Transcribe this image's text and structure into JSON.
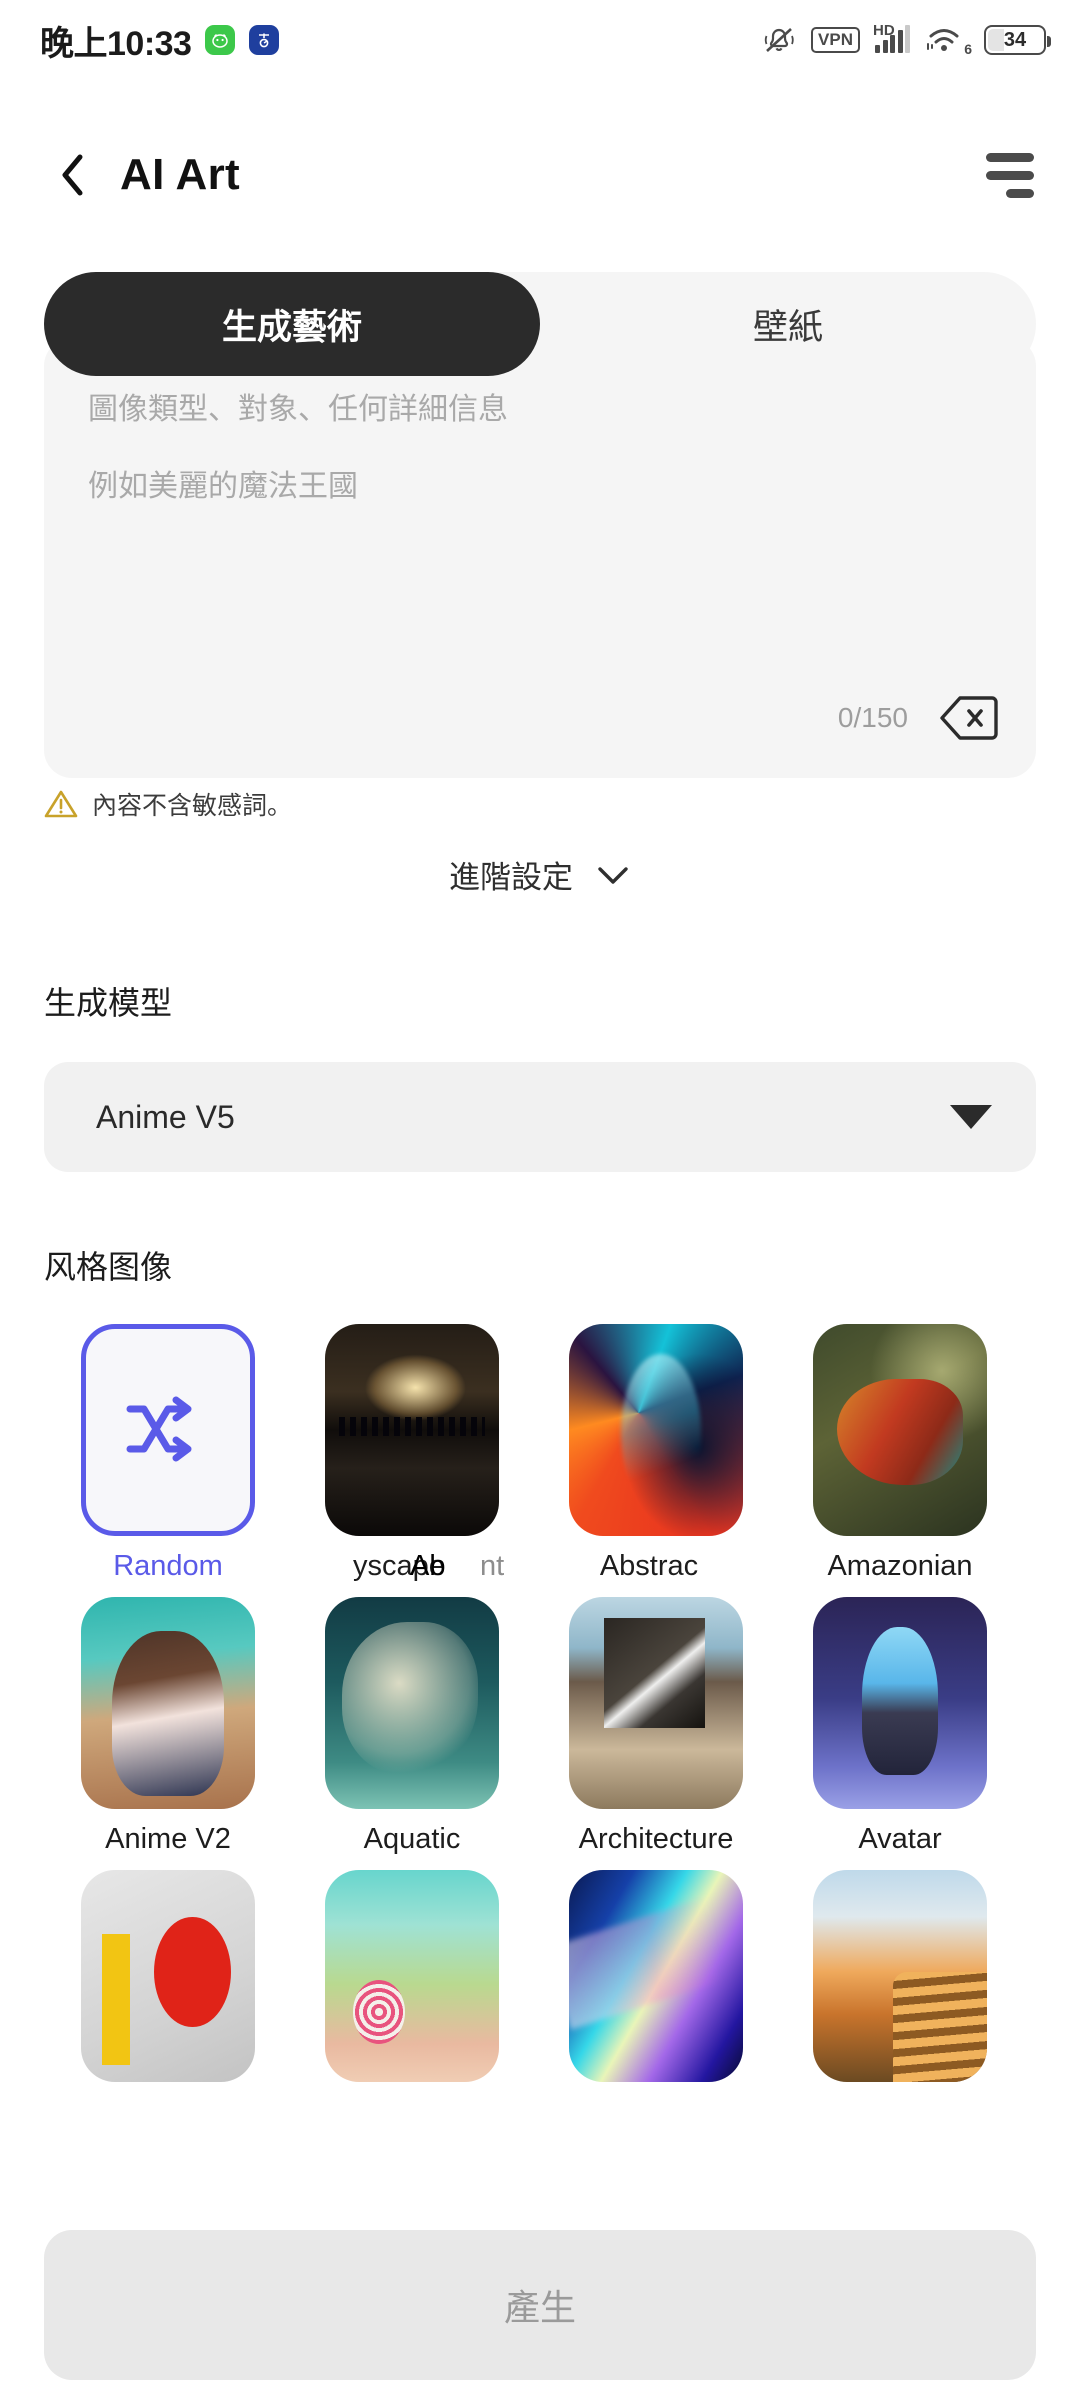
{
  "statusbar": {
    "time": "晚上10:33",
    "app_badges": [
      {
        "name": "green-app-icon",
        "glyph": "●"
      },
      {
        "name": "blue-app-icon",
        "glyph": "●"
      }
    ],
    "vpn_label": "VPN",
    "hd_label": "HD",
    "wifi_generation": "6",
    "battery_level": "34"
  },
  "header": {
    "back_icon": "back-chevron-icon",
    "title": "AI Art",
    "menu_icon": "hamburger-menu-icon"
  },
  "tabs": [
    {
      "label": "生成藝術",
      "active": true
    },
    {
      "label": "壁紙",
      "active": false
    }
  ],
  "prompt": {
    "placeholder_line1": "圖像類型、對象、任何詳細信息",
    "placeholder_line2": "例如美麗的魔法王國",
    "value": "",
    "counter": "0/150",
    "clear_icon": "backspace-icon"
  },
  "warning": {
    "icon": "warning-triangle-icon",
    "text": "內容不含敏感詞。"
  },
  "advanced": {
    "label": "進階設定",
    "icon": "chevron-down-icon"
  },
  "model": {
    "section_label": "生成模型",
    "selected": "Anime V5",
    "caret_icon": "caret-down-icon"
  },
  "style": {
    "section_label": "风格图像",
    "row1_labels": [
      {
        "text": "Random",
        "state": "selected"
      },
      {
        "text": "yscape",
        "state": "clipped"
      },
      {
        "text": "Ab",
        "state": "faded"
      },
      {
        "text": "nt",
        "state": "faded"
      },
      {
        "text": "Abstrac",
        "state": "clipped"
      },
      {
        "text": "Amazonian",
        "state": "normal"
      }
    ],
    "items": [
      {
        "label": "Random",
        "art": "random",
        "selected": true
      },
      {
        "label": "Cityscape",
        "art": "art-cityscape",
        "selected": false
      },
      {
        "label": "Abstract",
        "art": "art-abstract",
        "selected": false
      },
      {
        "label": "Amazonian",
        "art": "art-amazon",
        "selected": false
      },
      {
        "label": "Anime V2",
        "art": "art-animev2",
        "selected": false
      },
      {
        "label": "Aquatic",
        "art": "art-aquatic",
        "selected": false
      },
      {
        "label": "Architecture",
        "art": "art-arch",
        "selected": false
      },
      {
        "label": "Avatar",
        "art": "art-avatar",
        "selected": false
      },
      {
        "label": "",
        "art": "art-bauhaus",
        "selected": false
      },
      {
        "label": "",
        "art": "art-candy",
        "selected": false
      },
      {
        "label": "",
        "art": "art-holo",
        "selected": false
      },
      {
        "label": "",
        "art": "art-canyon",
        "selected": false
      }
    ]
  },
  "generate": {
    "label": "產生",
    "enabled": false
  },
  "colors": {
    "accent": "#5a5ae8",
    "tab_active_bg": "#2b2b2b",
    "surface": "#f5f5f5",
    "warning": "#c8a22a"
  }
}
